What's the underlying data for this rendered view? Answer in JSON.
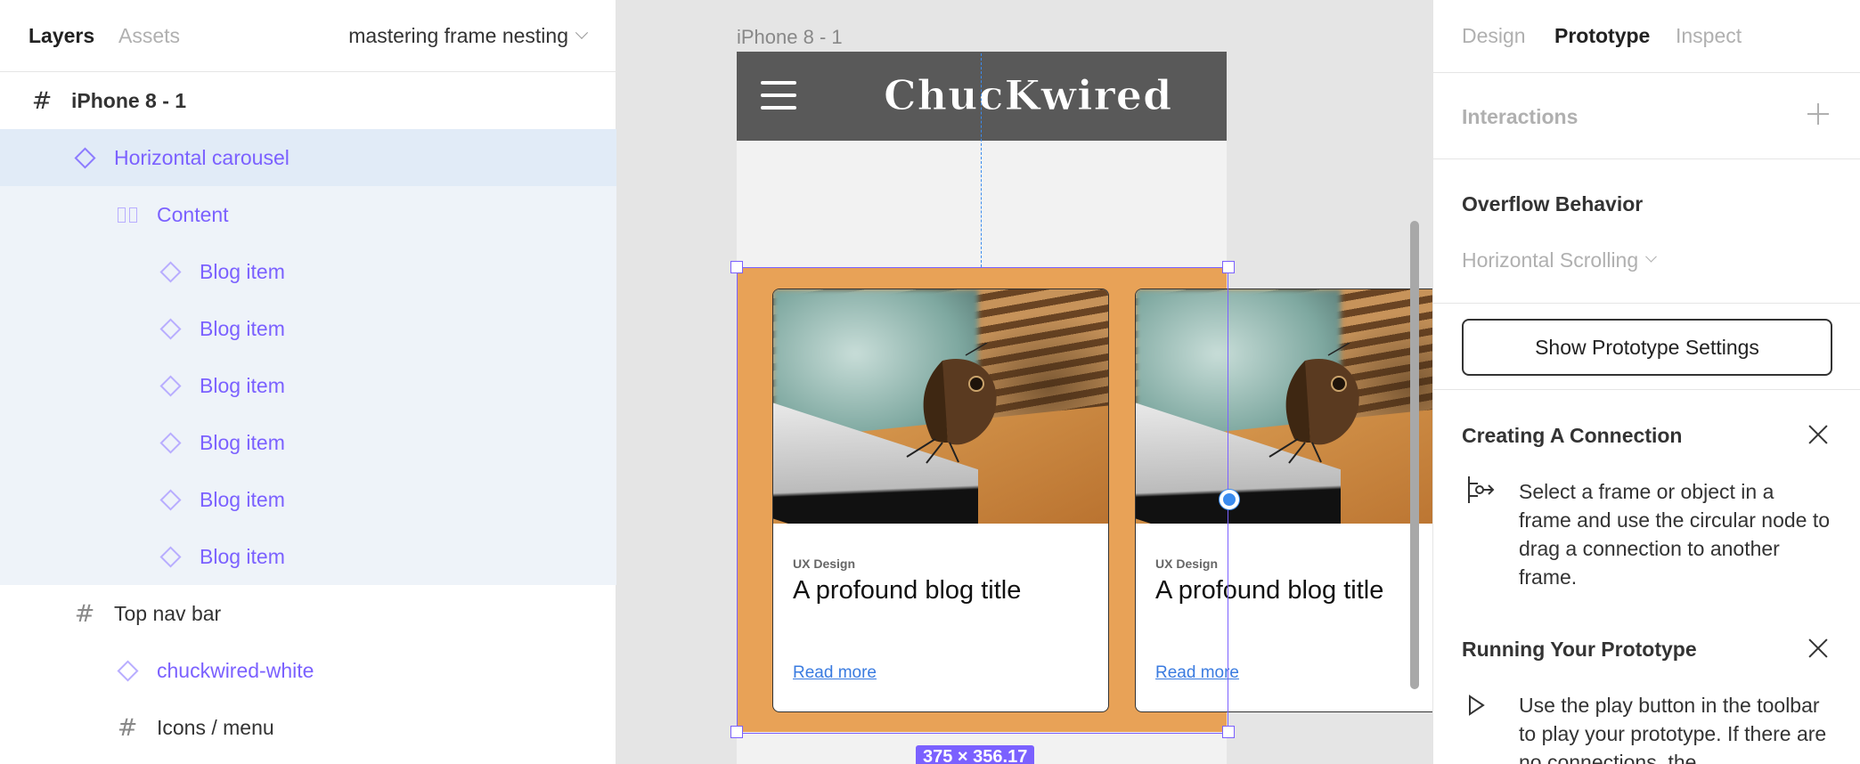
{
  "left_panel": {
    "tabs": {
      "layers": "Layers",
      "assets": "Assets"
    },
    "page_name": "mastering frame nesting",
    "layers": [
      {
        "label": "iPhone 8 - 1",
        "icon": "frame-icon"
      },
      {
        "label": "Horizontal carousel",
        "icon": "component-instance-icon"
      },
      {
        "label": "Content",
        "icon": "column-layout-icon"
      },
      {
        "label": "Blog item",
        "icon": "component-instance-icon"
      },
      {
        "label": "Blog item",
        "icon": "component-instance-icon"
      },
      {
        "label": "Blog item",
        "icon": "component-instance-icon"
      },
      {
        "label": "Blog item",
        "icon": "component-instance-icon"
      },
      {
        "label": "Blog item",
        "icon": "component-instance-icon"
      },
      {
        "label": "Blog item",
        "icon": "component-instance-icon"
      },
      {
        "label": "Top nav bar",
        "icon": "frame-icon"
      },
      {
        "label": "chuckwired-white",
        "icon": "component-instance-icon"
      },
      {
        "label": "Icons / menu",
        "icon": "frame-icon"
      }
    ]
  },
  "canvas": {
    "frame_label": "iPhone 8 - 1",
    "logo_text": "ChucKwired",
    "dimension_badge": "375 × 356.17",
    "cards": [
      {
        "category": "UX Design",
        "title": "A profound blog title",
        "link": "Read more"
      },
      {
        "category": "UX Design",
        "title": "A profound blog title",
        "link": "Read more"
      }
    ],
    "colors": {
      "carousel_bg": "#e8a257",
      "nav_bg": "#595959",
      "selection": "#7b61ff",
      "link": "#3a7be0"
    }
  },
  "right_panel": {
    "tabs": {
      "design": "Design",
      "prototype": "Prototype",
      "inspect": "Inspect"
    },
    "interactions_label": "Interactions",
    "overflow_title": "Overflow Behavior",
    "overflow_value": "Horizontal Scrolling",
    "prototype_settings_button": "Show Prototype Settings",
    "creating_title": "Creating A Connection",
    "creating_body": "Select a frame or object in a frame and use the circular node to drag a connection to another frame.",
    "running_title": "Running Your Prototype",
    "running_body": "Use the play button in the toolbar to play your prototype. If there are no connections, the"
  }
}
